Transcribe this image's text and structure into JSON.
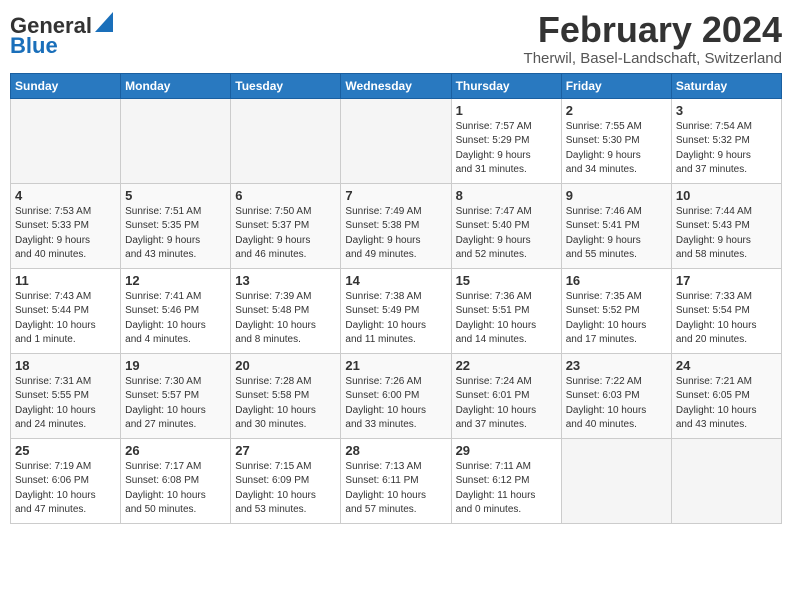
{
  "header": {
    "logo_text1": "General",
    "logo_text2": "Blue",
    "month_title": "February 2024",
    "location": "Therwil, Basel-Landschaft, Switzerland"
  },
  "weekdays": [
    "Sunday",
    "Monday",
    "Tuesday",
    "Wednesday",
    "Thursday",
    "Friday",
    "Saturday"
  ],
  "weeks": [
    [
      {
        "day": "",
        "info": ""
      },
      {
        "day": "",
        "info": ""
      },
      {
        "day": "",
        "info": ""
      },
      {
        "day": "",
        "info": ""
      },
      {
        "day": "1",
        "info": "Sunrise: 7:57 AM\nSunset: 5:29 PM\nDaylight: 9 hours\nand 31 minutes."
      },
      {
        "day": "2",
        "info": "Sunrise: 7:55 AM\nSunset: 5:30 PM\nDaylight: 9 hours\nand 34 minutes."
      },
      {
        "day": "3",
        "info": "Sunrise: 7:54 AM\nSunset: 5:32 PM\nDaylight: 9 hours\nand 37 minutes."
      }
    ],
    [
      {
        "day": "4",
        "info": "Sunrise: 7:53 AM\nSunset: 5:33 PM\nDaylight: 9 hours\nand 40 minutes."
      },
      {
        "day": "5",
        "info": "Sunrise: 7:51 AM\nSunset: 5:35 PM\nDaylight: 9 hours\nand 43 minutes."
      },
      {
        "day": "6",
        "info": "Sunrise: 7:50 AM\nSunset: 5:37 PM\nDaylight: 9 hours\nand 46 minutes."
      },
      {
        "day": "7",
        "info": "Sunrise: 7:49 AM\nSunset: 5:38 PM\nDaylight: 9 hours\nand 49 minutes."
      },
      {
        "day": "8",
        "info": "Sunrise: 7:47 AM\nSunset: 5:40 PM\nDaylight: 9 hours\nand 52 minutes."
      },
      {
        "day": "9",
        "info": "Sunrise: 7:46 AM\nSunset: 5:41 PM\nDaylight: 9 hours\nand 55 minutes."
      },
      {
        "day": "10",
        "info": "Sunrise: 7:44 AM\nSunset: 5:43 PM\nDaylight: 9 hours\nand 58 minutes."
      }
    ],
    [
      {
        "day": "11",
        "info": "Sunrise: 7:43 AM\nSunset: 5:44 PM\nDaylight: 10 hours\nand 1 minute."
      },
      {
        "day": "12",
        "info": "Sunrise: 7:41 AM\nSunset: 5:46 PM\nDaylight: 10 hours\nand 4 minutes."
      },
      {
        "day": "13",
        "info": "Sunrise: 7:39 AM\nSunset: 5:48 PM\nDaylight: 10 hours\nand 8 minutes."
      },
      {
        "day": "14",
        "info": "Sunrise: 7:38 AM\nSunset: 5:49 PM\nDaylight: 10 hours\nand 11 minutes."
      },
      {
        "day": "15",
        "info": "Sunrise: 7:36 AM\nSunset: 5:51 PM\nDaylight: 10 hours\nand 14 minutes."
      },
      {
        "day": "16",
        "info": "Sunrise: 7:35 AM\nSunset: 5:52 PM\nDaylight: 10 hours\nand 17 minutes."
      },
      {
        "day": "17",
        "info": "Sunrise: 7:33 AM\nSunset: 5:54 PM\nDaylight: 10 hours\nand 20 minutes."
      }
    ],
    [
      {
        "day": "18",
        "info": "Sunrise: 7:31 AM\nSunset: 5:55 PM\nDaylight: 10 hours\nand 24 minutes."
      },
      {
        "day": "19",
        "info": "Sunrise: 7:30 AM\nSunset: 5:57 PM\nDaylight: 10 hours\nand 27 minutes."
      },
      {
        "day": "20",
        "info": "Sunrise: 7:28 AM\nSunset: 5:58 PM\nDaylight: 10 hours\nand 30 minutes."
      },
      {
        "day": "21",
        "info": "Sunrise: 7:26 AM\nSunset: 6:00 PM\nDaylight: 10 hours\nand 33 minutes."
      },
      {
        "day": "22",
        "info": "Sunrise: 7:24 AM\nSunset: 6:01 PM\nDaylight: 10 hours\nand 37 minutes."
      },
      {
        "day": "23",
        "info": "Sunrise: 7:22 AM\nSunset: 6:03 PM\nDaylight: 10 hours\nand 40 minutes."
      },
      {
        "day": "24",
        "info": "Sunrise: 7:21 AM\nSunset: 6:05 PM\nDaylight: 10 hours\nand 43 minutes."
      }
    ],
    [
      {
        "day": "25",
        "info": "Sunrise: 7:19 AM\nSunset: 6:06 PM\nDaylight: 10 hours\nand 47 minutes."
      },
      {
        "day": "26",
        "info": "Sunrise: 7:17 AM\nSunset: 6:08 PM\nDaylight: 10 hours\nand 50 minutes."
      },
      {
        "day": "27",
        "info": "Sunrise: 7:15 AM\nSunset: 6:09 PM\nDaylight: 10 hours\nand 53 minutes."
      },
      {
        "day": "28",
        "info": "Sunrise: 7:13 AM\nSunset: 6:11 PM\nDaylight: 10 hours\nand 57 minutes."
      },
      {
        "day": "29",
        "info": "Sunrise: 7:11 AM\nSunset: 6:12 PM\nDaylight: 11 hours\nand 0 minutes."
      },
      {
        "day": "",
        "info": ""
      },
      {
        "day": "",
        "info": ""
      }
    ]
  ]
}
